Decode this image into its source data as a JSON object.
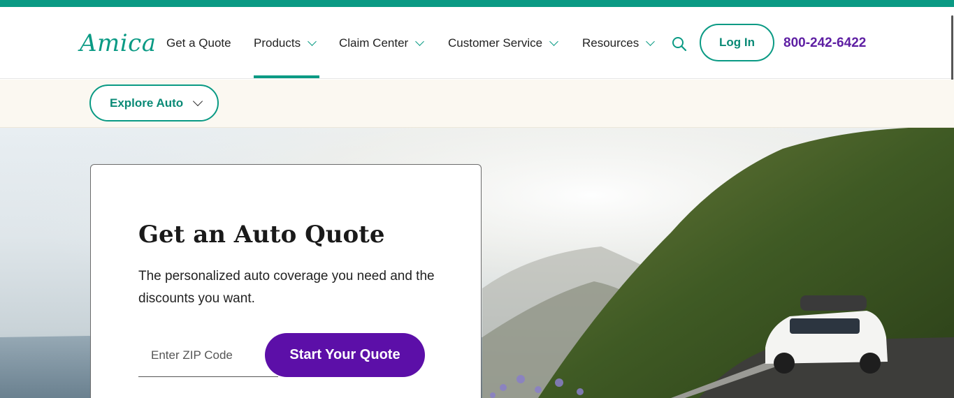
{
  "brand": {
    "logo_text": "Amica",
    "accent": "#0a9a84",
    "purple": "#5c0fa8"
  },
  "nav": {
    "get_quote": "Get a Quote",
    "products": "Products",
    "claim_center": "Claim Center",
    "customer_service": "Customer Service",
    "resources": "Resources",
    "search_icon": "search-icon",
    "login": "Log In",
    "phone": "800-242-6422"
  },
  "subnav": {
    "explore": "Explore Auto"
  },
  "hero": {
    "title": "Get an Auto Quote",
    "description": "The personalized auto coverage you need and the discounts you want.",
    "zip_placeholder": "Enter ZIP Code",
    "cta": "Start Your Quote"
  }
}
